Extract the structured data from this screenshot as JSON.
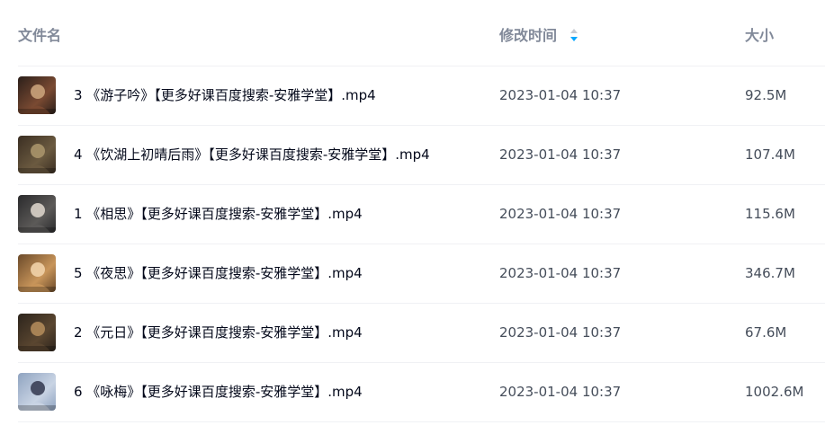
{
  "header": {
    "name_label": "文件名",
    "time_label": "修改时间",
    "size_label": "大小",
    "sort_icon": "sort-toggle-icon",
    "sort_color_up": "#c7cbd3",
    "sort_color_down": "#06a7ff"
  },
  "files": [
    {
      "name": "3 《游子吟》【更多好课百度搜索-安雅学堂】.mp4",
      "modified": "2023-01-04 10:37",
      "size": "92.5M",
      "thumb_colors": [
        "#2b1f1a",
        "#7a4a32",
        "#c9a27a"
      ]
    },
    {
      "name": "4 《饮湖上初晴后雨》【更多好课百度搜索-安雅学堂】.mp4",
      "modified": "2023-01-04 10:37",
      "size": "107.4M",
      "thumb_colors": [
        "#3a2e22",
        "#6b5a40",
        "#a8946a"
      ]
    },
    {
      "name": "1 《相思》【更多好课百度搜索-安雅学堂】.mp4",
      "modified": "2023-01-04 10:37",
      "size": "115.6M",
      "thumb_colors": [
        "#2a2a2c",
        "#5c5a58",
        "#d9d2c8"
      ]
    },
    {
      "name": "5 《夜思》【更多好课百度搜索-安雅学堂】.mp4",
      "modified": "2023-01-04 10:37",
      "size": "346.7M",
      "thumb_colors": [
        "#6b4a2a",
        "#c8955a",
        "#f1d2a8"
      ]
    },
    {
      "name": "2 《元日》【更多好课百度搜索-安雅学堂】.mp4",
      "modified": "2023-01-04 10:37",
      "size": "67.6M",
      "thumb_colors": [
        "#2c241c",
        "#5a4630",
        "#b08a5a"
      ]
    },
    {
      "name": "6 《咏梅》【更多好课百度搜索-安雅学堂】.mp4",
      "modified": "2023-01-04 10:37",
      "size": "1002.6M",
      "thumb_colors": [
        "#8fa3c0",
        "#c9d4e4",
        "#3a3f55"
      ]
    }
  ]
}
